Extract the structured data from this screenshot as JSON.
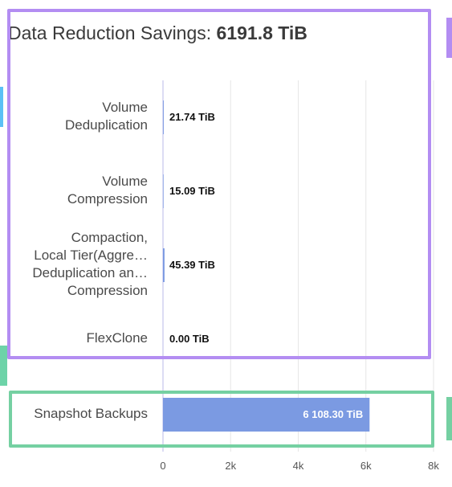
{
  "title": {
    "prefix": "Data Reduction Savings:",
    "value": "6191.8 TiB"
  },
  "colors": {
    "bar": "#7b9ae2",
    "frame_purple": "#b38df2",
    "frame_green": "#75d0a2",
    "grid": "#e6e6e6",
    "axis": "#d0d0f0",
    "edge_blue": "#5bc0f5",
    "edge_teal": "#6dd3a8"
  },
  "chart_data": {
    "type": "bar",
    "orientation": "horizontal",
    "categories": [
      "Volume Deduplication",
      "Volume Compression",
      "Compaction, Local Tier(Aggre… Deduplication an… Compression",
      "FlexClone",
      "Snapshot Backups"
    ],
    "category_lines": [
      [
        "Volume",
        "Deduplication"
      ],
      [
        "Volume",
        "Compression"
      ],
      [
        "Compaction,",
        "Local Tier(Aggre…",
        "Deduplication an…",
        "Compression"
      ],
      [
        "FlexClone"
      ],
      [
        "Snapshot Backups"
      ]
    ],
    "values": [
      21.74,
      15.09,
      45.39,
      0.0,
      6108.3
    ],
    "value_labels": [
      "21.74 TiB",
      "15.09 TiB",
      "45.39 TiB",
      "0.00 TiB",
      "6 108.30 TiB"
    ],
    "units": "TiB",
    "xlim": [
      0,
      8000
    ],
    "xticks": [
      0,
      2000,
      4000,
      6000,
      8000
    ],
    "xtick_labels": [
      "0",
      "2k",
      "4k",
      "6k",
      "8k"
    ],
    "grid": true,
    "legend": "none",
    "xlabel": "",
    "ylabel": ""
  }
}
